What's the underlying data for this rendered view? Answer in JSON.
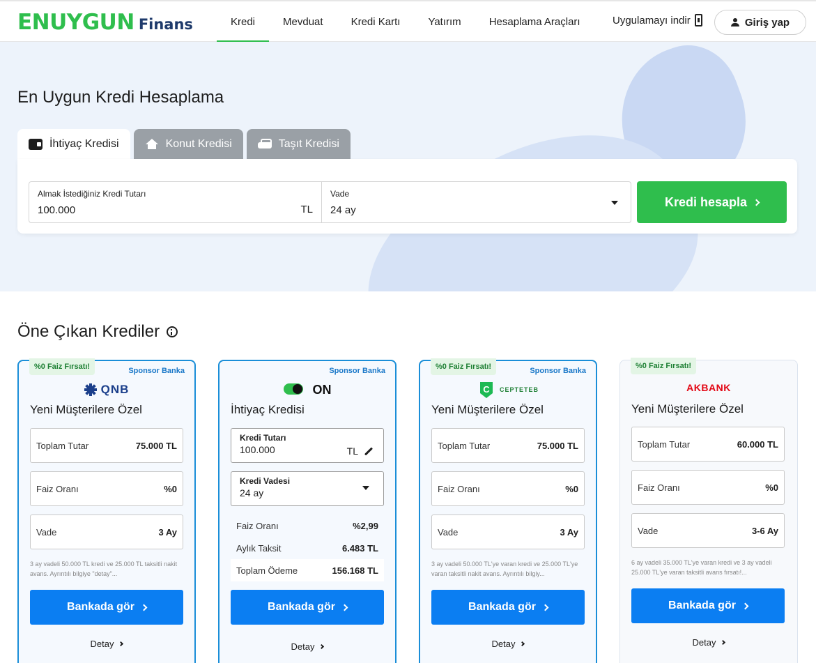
{
  "header": {
    "logo_main": "ENUYGUN",
    "logo_sub": "Finans",
    "nav": [
      "Kredi",
      "Mevduat",
      "Kredi Kartı",
      "Yatırım",
      "Hesaplama Araçları"
    ],
    "app_download": "Uygulamayı indir",
    "login": "Giriş yap"
  },
  "hero": {
    "title": "En Uygun Kredi Hesaplama",
    "tabs": [
      "İhtiyaç Kredisi",
      "Konut Kredisi",
      "Taşıt Kredisi"
    ],
    "amount_label": "Almak İstediğiniz Kredi Tutarı",
    "amount_value": "100.000",
    "amount_unit": "TL",
    "term_label": "Vade",
    "term_value": "24 ay",
    "calc_button": "Kredi hesapla"
  },
  "featured": {
    "title": "Öne Çıkan Krediler",
    "cards": [
      {
        "badge": "%0 Faiz Fırsatı!",
        "sponsor": "Sponsor Banka",
        "bank": "QNB",
        "title": "Yeni Müşterilere Özel",
        "rows": [
          {
            "label": "Toplam Tutar",
            "value": "75.000 TL"
          },
          {
            "label": "Faiz Oranı",
            "value": "%0"
          },
          {
            "label": "Vade",
            "value": "3 Ay"
          }
        ],
        "note": "3 ay vadeli 50.000 TL kredi ve 25.000 TL taksitli nakit avans. Ayrıntılı bilgiye \"detay\"...",
        "button": "Bankada gör",
        "detail": "Detay"
      },
      {
        "sponsor": "Sponsor Banka",
        "bank": "ON",
        "title": "İhtiyaç Kredisi",
        "amount_label": "Kredi Tutarı",
        "amount_value": "100.000",
        "amount_unit": "TL",
        "term_label": "Kredi Vadesi",
        "term_value": "24 ay",
        "stats": [
          {
            "label": "Faiz Oranı",
            "value": "%2,99"
          },
          {
            "label": "Aylık Taksit",
            "value": "6.483 TL"
          },
          {
            "label": "Toplam Ödeme",
            "value": "156.168 TL"
          }
        ],
        "button": "Bankada gör",
        "detail": "Detay"
      },
      {
        "badge": "%0 Faiz Fırsatı!",
        "sponsor": "Sponsor Banka",
        "bank": "CEPTETEB",
        "title": "Yeni Müşterilere Özel",
        "rows": [
          {
            "label": "Toplam Tutar",
            "value": "75.000 TL"
          },
          {
            "label": "Faiz Oranı",
            "value": "%0"
          },
          {
            "label": "Vade",
            "value": "3 Ay"
          }
        ],
        "note": "3 ay vadeli 50.000 TL'ye varan kredi ve 25.000 TL'ye varan taksitli nakit avans. Ayrıntılı bilgiy...",
        "button": "Bankada gör",
        "detail": "Detay"
      },
      {
        "badge": "%0 Faiz Fırsatı!",
        "bank": "AKBANK",
        "title": "Yeni Müşterilere Özel",
        "rows": [
          {
            "label": "Toplam Tutar",
            "value": "60.000 TL"
          },
          {
            "label": "Faiz Oranı",
            "value": "%0"
          },
          {
            "label": "Vade",
            "value": "3-6 Ay"
          }
        ],
        "note": "6 ay vadeli 35.000 TL'ye varan kredi ve 3 ay vadeli 25.000 TL'ye varan taksitli avans fırsatı!...",
        "button": "Bankada gör",
        "detail": "Detay"
      }
    ]
  },
  "colors": {
    "brand_green": "#2fbe4d",
    "primary_blue": "#0b7ef2",
    "hero_bg": "#edf3fb",
    "akbank_red": "#e30613"
  }
}
